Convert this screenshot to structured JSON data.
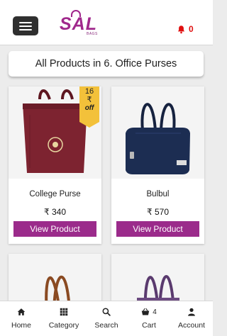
{
  "header": {
    "logo_main": "SAL",
    "logo_sub": "BAGS",
    "notification_count": "0",
    "menu_icon": "hamburger-menu-icon",
    "notification_icon": "bell-icon"
  },
  "page_title": "All Products in 6. Office Purses",
  "products": [
    {
      "name": "College Purse",
      "price": "₹ 340",
      "button_label": "View Product",
      "discount_badge": {
        "value": "16",
        "unit": "₹",
        "suffix": "off"
      },
      "image_color": "#7d2330"
    },
    {
      "name": "Bulbul",
      "price": "₹ 570",
      "button_label": "View Product",
      "image_color": "#1c2d52"
    },
    {
      "image_color": "#8a4a22"
    },
    {
      "image_color": "#5a3a6e"
    }
  ],
  "bottom_nav": [
    {
      "label": "Home",
      "icon": "home-icon"
    },
    {
      "label": "Category",
      "icon": "grid-icon"
    },
    {
      "label": "Search",
      "icon": "search-icon"
    },
    {
      "label": "Cart",
      "icon": "basket-icon",
      "count": "4"
    },
    {
      "label": "Account",
      "icon": "user-icon"
    }
  ],
  "colors": {
    "brand": "#a0288c",
    "button": "#9b2b8b",
    "notification": "#e01010",
    "badge": "#f3c13a"
  }
}
